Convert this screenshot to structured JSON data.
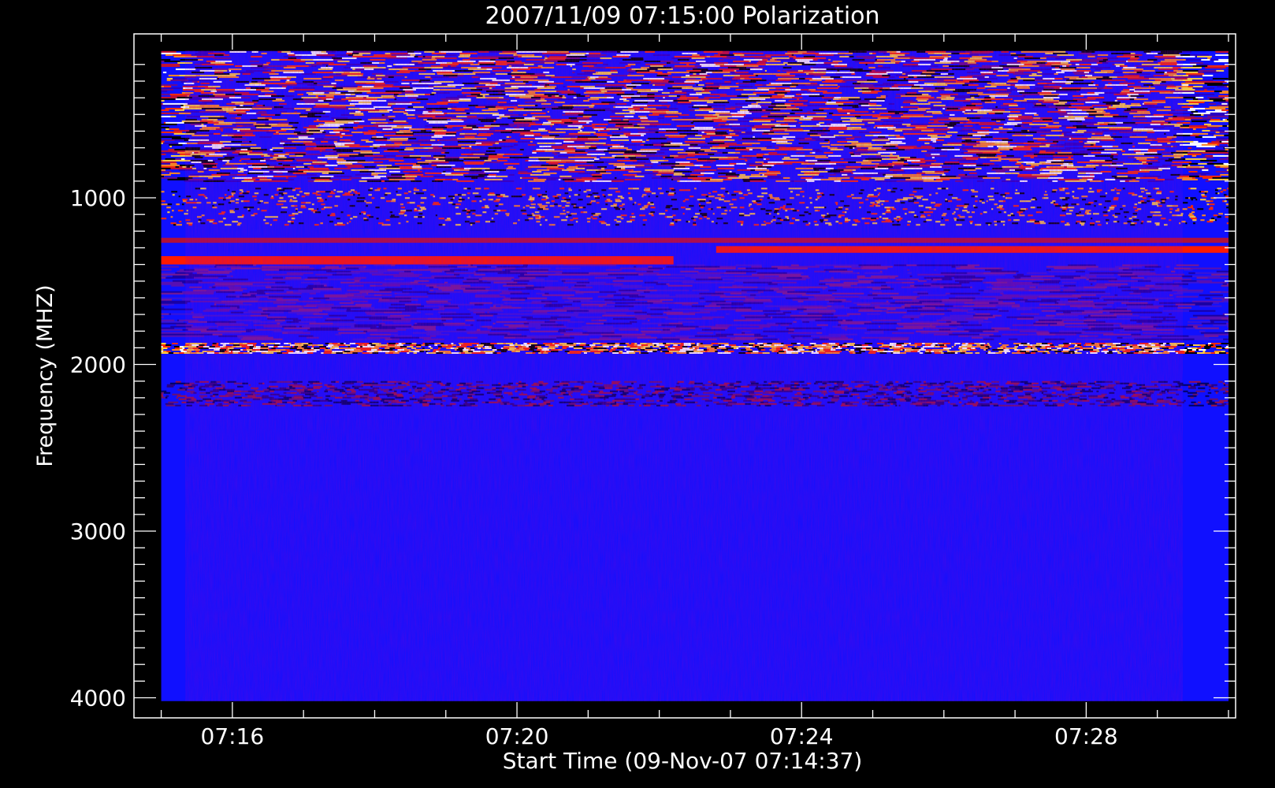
{
  "chart_data": {
    "type": "heatmap",
    "title": "2007/11/09 07:15:00 Polarization",
    "xlabel": "Start Time (09-Nov-07 07:14:37)",
    "ylabel": "Frequency (MHZ)",
    "x_range_minutes": [
      14.617,
      30.1
    ],
    "x_major_ticks": [
      {
        "label": "07:16",
        "minutes": 16
      },
      {
        "label": "07:20",
        "minutes": 20
      },
      {
        "label": "07:24",
        "minutes": 24
      },
      {
        "label": "07:28",
        "minutes": 28
      }
    ],
    "y_range": [
      1100,
      120
    ],
    "y_reversed": true,
    "y_major_ticks": [
      {
        "label": "1000",
        "value": 1000
      },
      {
        "label": "2000",
        "value": 2000
      },
      {
        "label": "3000",
        "value": 3000
      },
      {
        "label": "4000",
        "value": 4000
      }
    ],
    "data_extent": {
      "time_start_minutes": 15.0,
      "time_end_minutes": 30.0,
      "freq_low": 120,
      "freq_high": 4020
    },
    "colors": {
      "background": "#000000",
      "base": "#1010ff",
      "red": "#ff1a00",
      "orange": "#ff8a1e",
      "white": "#ffffff"
    },
    "bands": [
      {
        "f0": 120,
        "f1": 900,
        "style": "noisy"
      },
      {
        "f0": 940,
        "f1": 1160,
        "style": "sparse"
      },
      {
        "f0": 1240,
        "f1": 1270,
        "style": "red-dim"
      },
      {
        "f0": 1290,
        "f1": 1330,
        "style": "red-strong",
        "t0": 22.8,
        "t1": 30.0
      },
      {
        "f0": 1350,
        "f1": 1400,
        "style": "red-strong",
        "t0": 15.0,
        "t1": 22.2
      },
      {
        "f0": 1400,
        "f1": 1850,
        "style": "purple-mottled"
      },
      {
        "f0": 1870,
        "f1": 1930,
        "style": "orange-line"
      },
      {
        "f0": 2100,
        "f1": 2250,
        "style": "dark-speckle"
      }
    ]
  }
}
